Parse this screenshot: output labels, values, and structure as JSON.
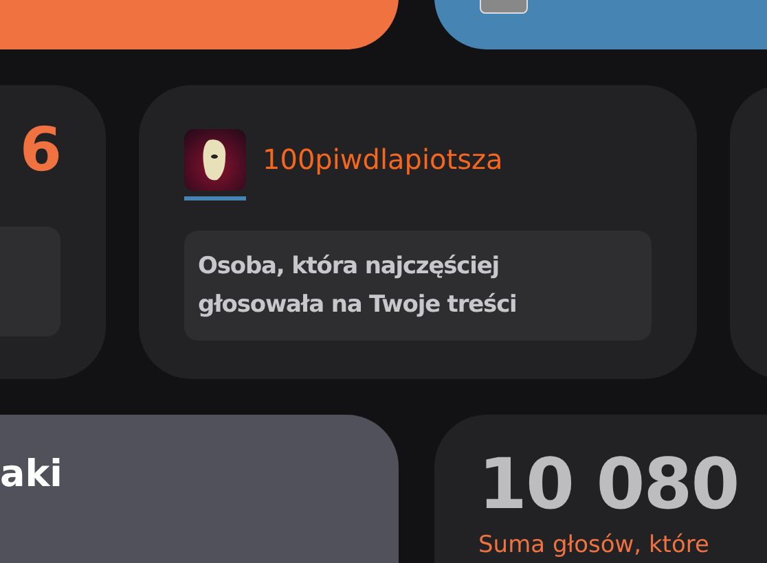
{
  "stat_card_left": {
    "value": "6"
  },
  "top_voter_card": {
    "username": "100piwdlapiotsza",
    "description": "Osoba, która najczęściej głosowała na Twoje treści"
  },
  "title_card": {
    "title": "aki"
  },
  "votes_card": {
    "value": "10 080",
    "caption": "Suma głosów, które"
  }
}
